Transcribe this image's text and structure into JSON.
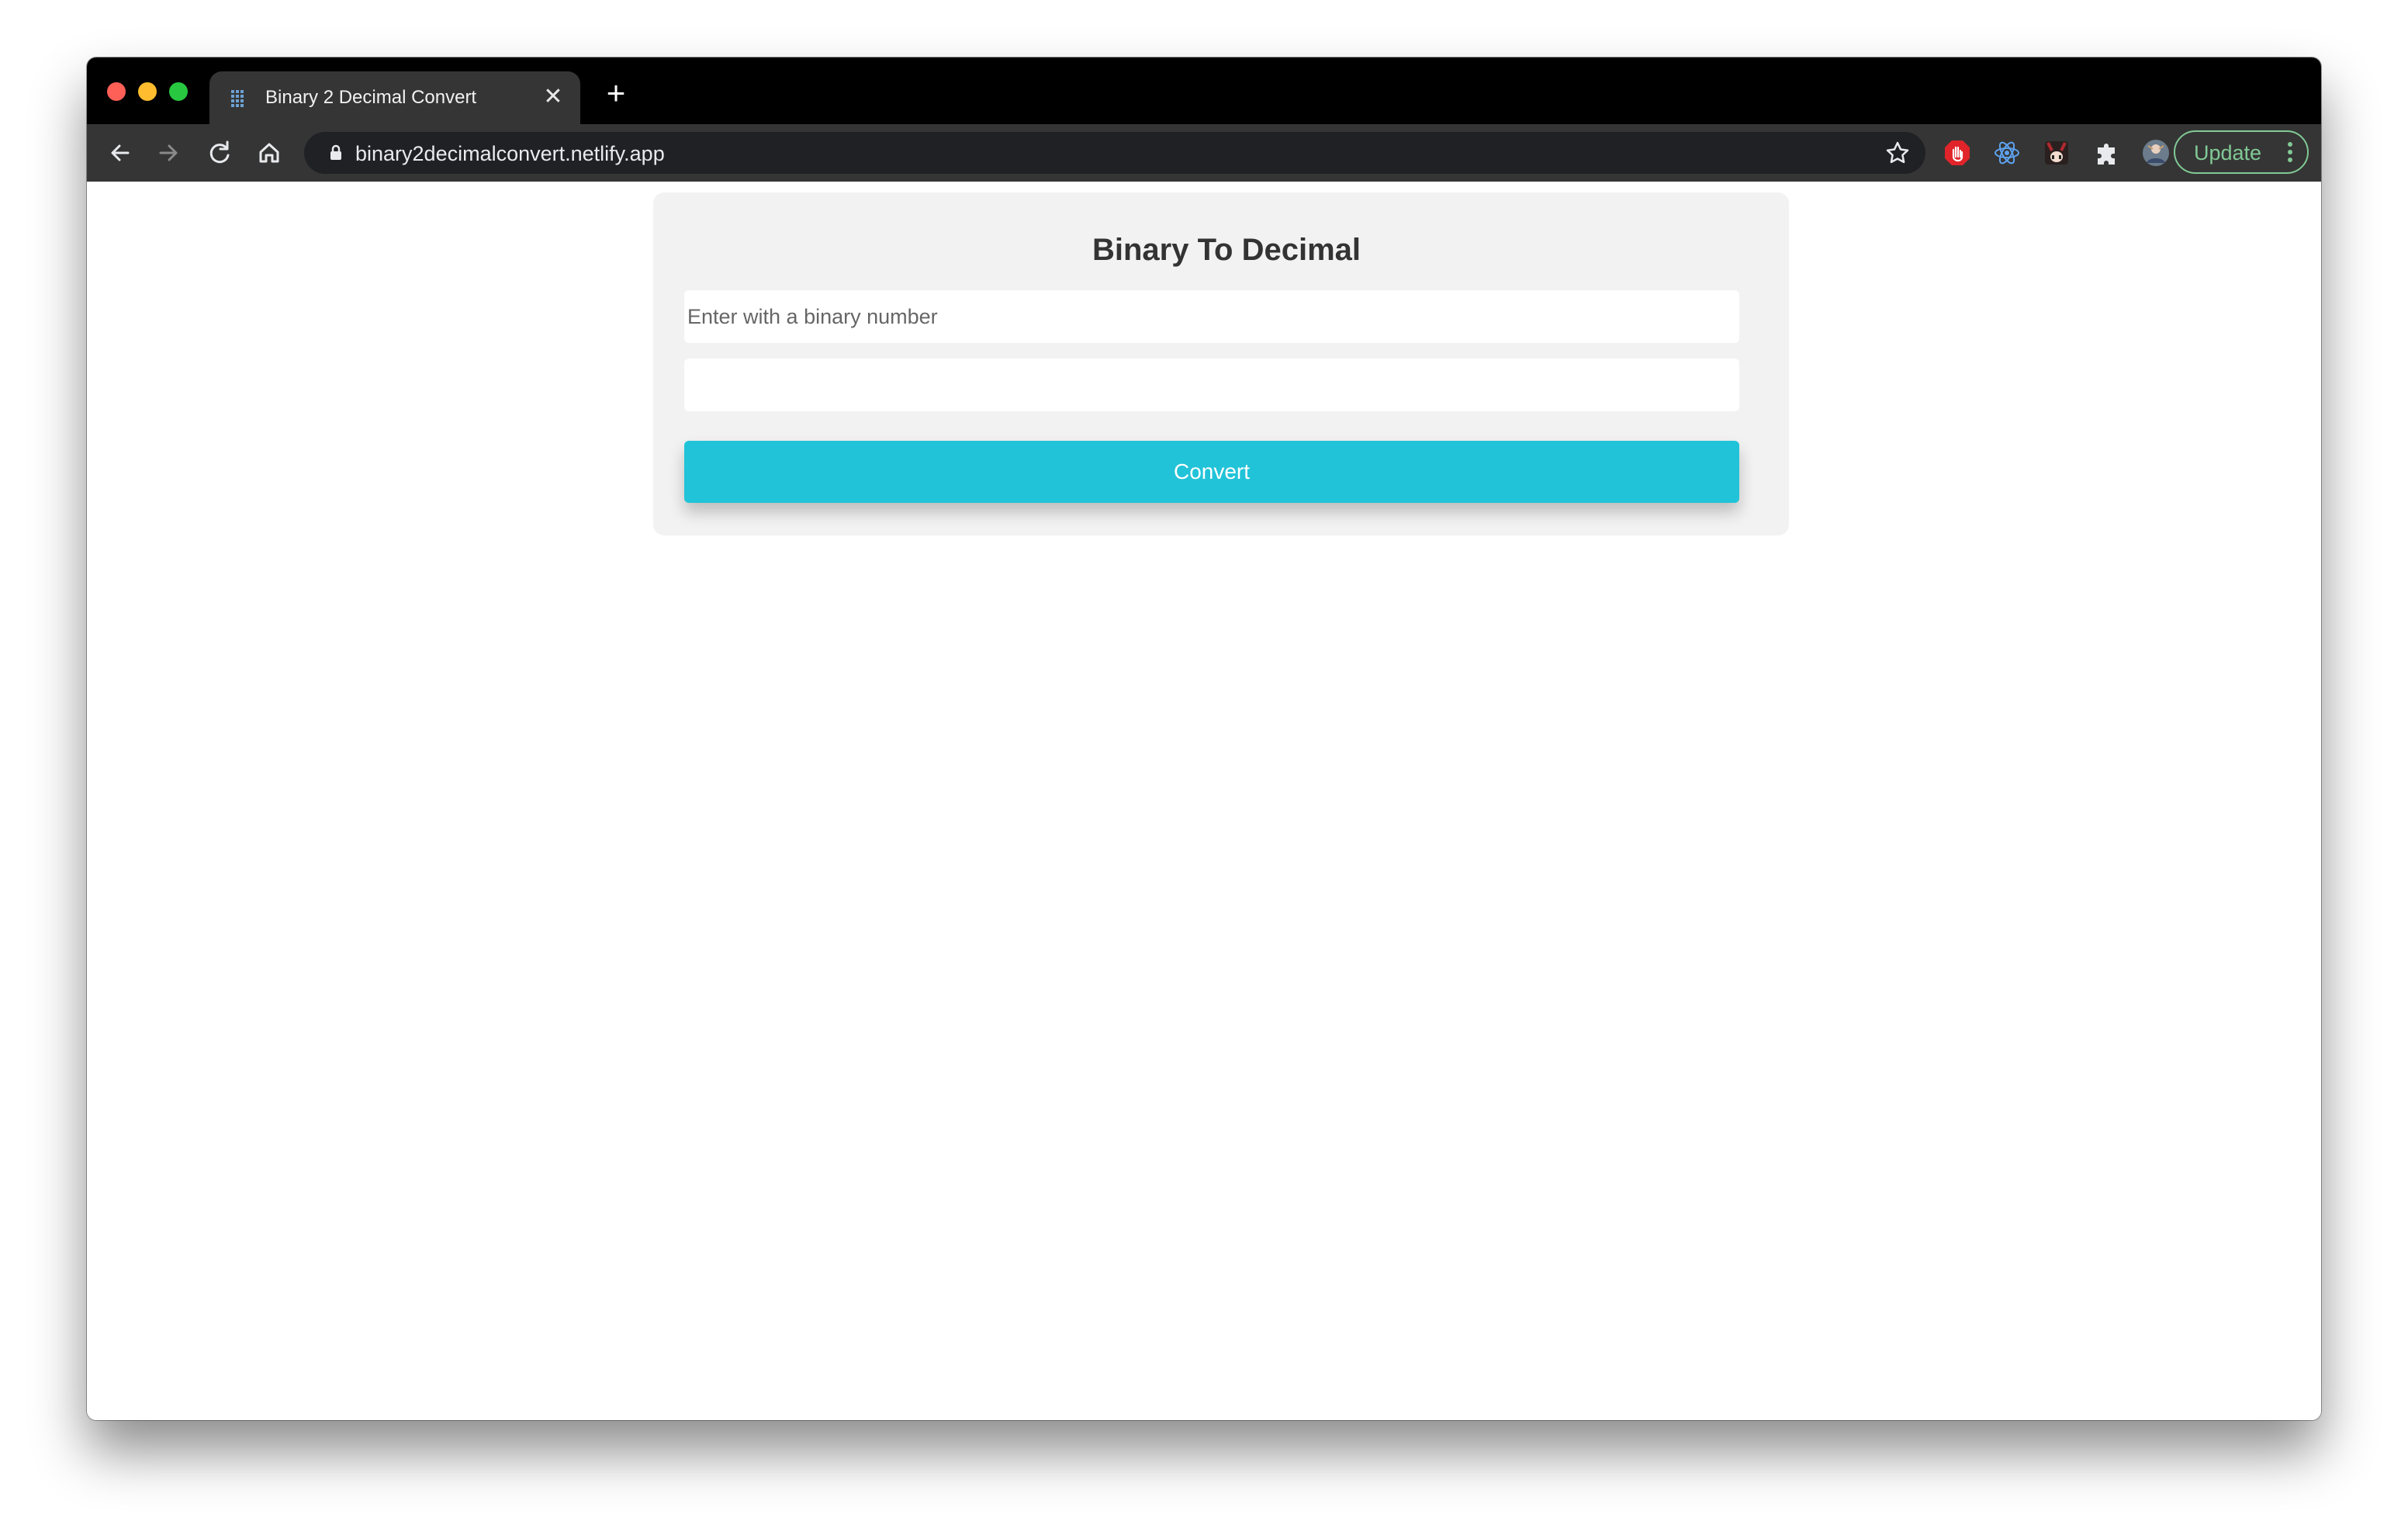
{
  "browser": {
    "tab": {
      "title": "Binary 2 Decimal Convert",
      "close_glyph": "✕",
      "favicon": "calculator-icon"
    },
    "new_tab_glyph": "+",
    "address_bar": {
      "url": "binary2decimalconvert.netlify.app"
    },
    "update_button": {
      "label": "Update"
    },
    "extensions": [
      "adblock-icon",
      "react-devtools-icon",
      "anime-extension-icon",
      "extensions-puzzle-icon",
      "profile-avatar"
    ],
    "colors": {
      "titlebar": "#000000",
      "toolbar": "#353535",
      "omnibox": "#202124",
      "update_accent": "#81c995"
    }
  },
  "app": {
    "title": "Binary To Decimal",
    "binary_input": {
      "placeholder": "Enter with a binary number",
      "value": ""
    },
    "decimal_output": {
      "value": ""
    },
    "convert_button": {
      "label": "Convert"
    },
    "colors": {
      "card_background": "#f2f2f2",
      "button": "#21c3d8"
    }
  }
}
